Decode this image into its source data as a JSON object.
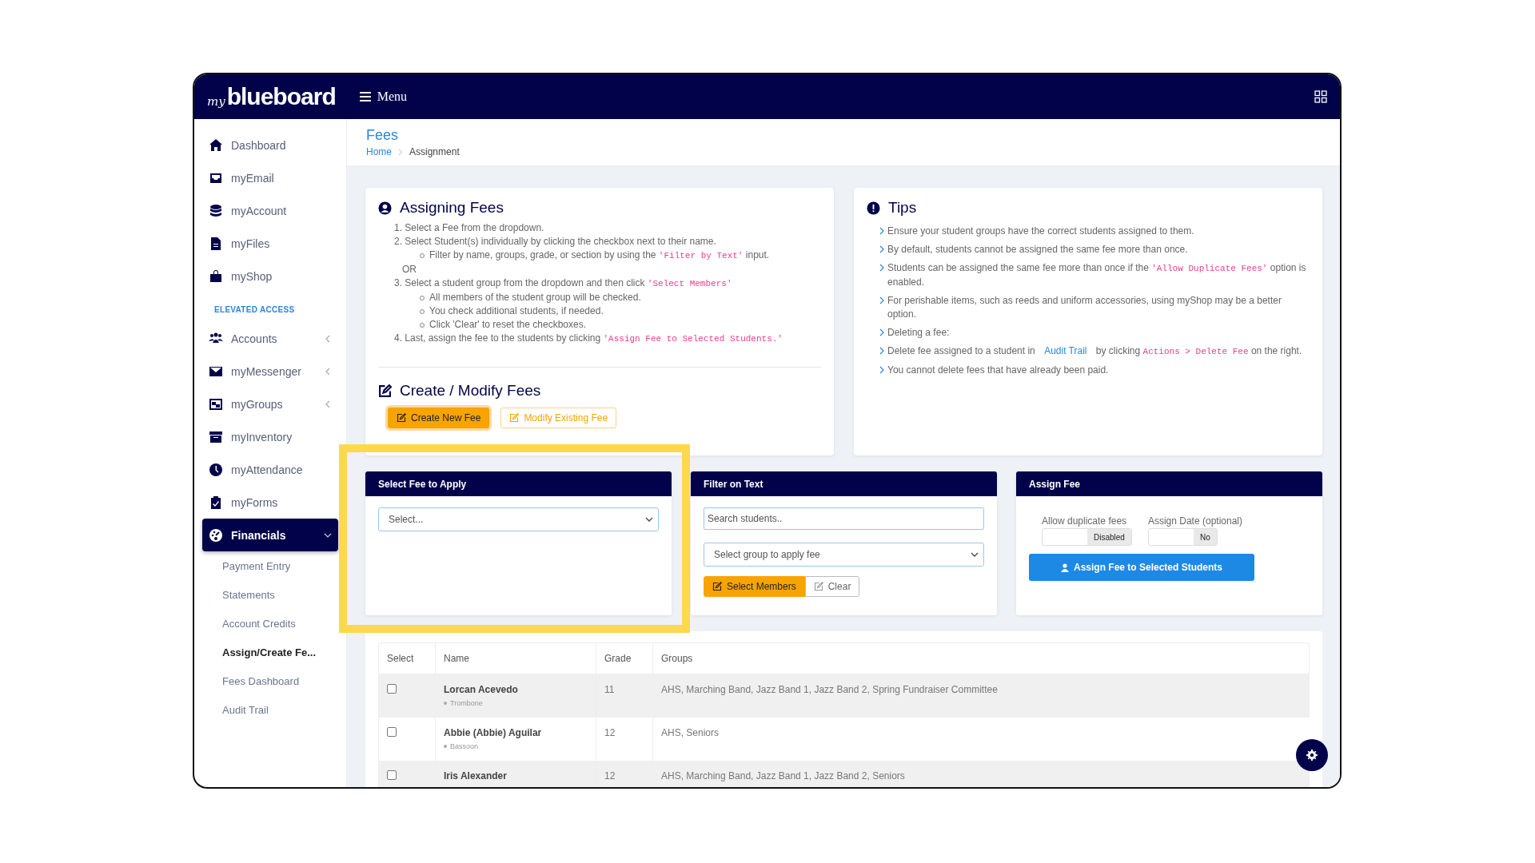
{
  "header": {
    "logo_prefix": "my",
    "logo": "blueboard",
    "menu_label": "Menu"
  },
  "sidebar": {
    "items": [
      {
        "kind": "link",
        "label": "Dashboard",
        "selected": false
      },
      {
        "kind": "link",
        "label": "myEmail",
        "selected": false
      },
      {
        "kind": "link",
        "label": "myAccount",
        "selected": false
      },
      {
        "kind": "link",
        "label": "myFiles",
        "selected": false
      },
      {
        "kind": "link",
        "label": "myShop",
        "selected": false
      },
      {
        "kind": "section",
        "label": "ELEVATED ACCESS"
      },
      {
        "kind": "group",
        "label": "Accounts",
        "selected": false,
        "expanded": false
      },
      {
        "kind": "group",
        "label": "myMessenger",
        "selected": false,
        "expanded": false
      },
      {
        "kind": "group",
        "label": "myGroups",
        "selected": false,
        "expanded": false
      },
      {
        "kind": "link",
        "label": "myInventory",
        "selected": false
      },
      {
        "kind": "link",
        "label": "myAttendance",
        "selected": false
      },
      {
        "kind": "link",
        "label": "myForms",
        "selected": false
      },
      {
        "kind": "group",
        "label": "Financials",
        "selected": true,
        "expanded": true,
        "children": [
          {
            "label": "Payment Entry",
            "selected": false
          },
          {
            "label": "Statements",
            "selected": false
          },
          {
            "label": "Account Credits",
            "selected": false
          },
          {
            "label": "Assign/Create Fe...",
            "selected": true
          },
          {
            "label": "Fees Dashboard",
            "selected": false
          },
          {
            "label": "Audit Trail",
            "selected": false
          }
        ]
      }
    ]
  },
  "page": {
    "title": "Fees",
    "breadcrumb": [
      "Home",
      "Assignment"
    ]
  },
  "assigning": {
    "title": "Assigning Fees",
    "lines": [
      {
        "kind": "step",
        "number": "1.",
        "parts": [
          {
            "kind": "text",
            "text": "Select a Fee from the dropdown."
          }
        ]
      },
      {
        "kind": "step",
        "number": "2.",
        "parts": [
          {
            "kind": "text",
            "text": "Select Student(s) individually by clicking the checkbox next to their name."
          }
        ]
      },
      {
        "kind": "sub",
        "parts": [
          {
            "kind": "text",
            "text": "Filter by name, groups, grade, or section by using the "
          },
          {
            "kind": "code",
            "text": "'Filter by Text'"
          },
          {
            "kind": "text",
            "text": " input."
          }
        ]
      },
      {
        "kind": "or",
        "parts": [
          {
            "kind": "text",
            "text": "OR"
          }
        ]
      },
      {
        "kind": "step",
        "number": "3.",
        "parts": [
          {
            "kind": "text",
            "text": "Select a student group from the dropdown and then click "
          },
          {
            "kind": "code",
            "text": "'Select Members'"
          }
        ]
      },
      {
        "kind": "sub",
        "parts": [
          {
            "kind": "text",
            "text": "All members of the student group will be checked."
          }
        ]
      },
      {
        "kind": "sub",
        "parts": [
          {
            "kind": "text",
            "text": "You check additional students, if needed."
          }
        ]
      },
      {
        "kind": "sub",
        "parts": [
          {
            "kind": "text",
            "text": "Click 'Clear' to reset the checkboxes."
          }
        ]
      },
      {
        "kind": "step",
        "number": "4.",
        "parts": [
          {
            "kind": "text",
            "text": "Last, assign the fee to the students by clicking "
          },
          {
            "kind": "code",
            "text": "'Assign Fee to Selected Students.'"
          }
        ]
      }
    ],
    "create_title": "Create / Modify Fees",
    "buttons": [
      {
        "label": "Create New Fee",
        "selected": true
      },
      {
        "label": "Modify Existing Fee",
        "selected": false
      }
    ]
  },
  "tips": {
    "title": "Tips",
    "items": [
      {
        "parts": [
          {
            "kind": "text",
            "text": "Ensure your student groups have the correct students assigned to them."
          }
        ]
      },
      {
        "parts": [
          {
            "kind": "text",
            "text": "By default, students cannot be assigned the same fee more than once."
          }
        ]
      },
      {
        "parts": [
          {
            "kind": "text",
            "text": "Students can be assigned the same fee more than once if the "
          },
          {
            "kind": "code",
            "text": "'Allow Duplicate Fees'"
          },
          {
            "kind": "text",
            "text": " option is enabled."
          }
        ]
      },
      {
        "parts": [
          {
            "kind": "text",
            "text": "For perishable items, such as reeds and uniform accessories, using myShop may be a better option."
          }
        ]
      },
      {
        "parts": [
          {
            "kind": "text",
            "text": "Deleting a fee:"
          }
        ]
      },
      {
        "parts": [
          {
            "kind": "text",
            "text": "Delete fee assigned to a student in "
          },
          {
            "kind": "link",
            "text": "Audit Trail"
          },
          {
            "kind": "text",
            "text": " by clicking "
          },
          {
            "kind": "code",
            "text": "Actions > Delete Fee"
          },
          {
            "kind": "text",
            "text": " on the right."
          }
        ]
      },
      {
        "parts": [
          {
            "kind": "text",
            "text": "You cannot delete fees that have already been paid."
          }
        ]
      }
    ]
  },
  "select_fee": {
    "title": "Select Fee to Apply",
    "dropdown": "Select..."
  },
  "filter": {
    "title": "Filter on Text",
    "search": {
      "placeholder": "Search students.."
    },
    "group_dropdown": "Select group to apply fee",
    "buttons": [
      {
        "label": "Select Members",
        "kind": "primary"
      },
      {
        "label": "Clear",
        "kind": "outline"
      }
    ]
  },
  "assign": {
    "title": "Assign Fee",
    "toggles": [
      {
        "label": "Allow duplicate fees",
        "value": "Disabled",
        "on": false
      },
      {
        "label": "Assign Date (optional)",
        "value": "No",
        "on": false
      }
    ],
    "button": "Assign Fee to Selected Students"
  },
  "table": {
    "columns": [
      "Select",
      "Name",
      "Grade",
      "Groups"
    ],
    "rows": [
      {
        "checked": false,
        "name": "Lorcan Acevedo",
        "instrument": "Trombone",
        "grade": "11",
        "groups": "AHS, Marching Band, Jazz Band 1, Jazz Band 2, Spring Fundraiser Committee"
      },
      {
        "checked": false,
        "name": "Abbie (Abbie) Aguilar",
        "instrument": "Bassoon",
        "grade": "12",
        "groups": "AHS, Seniors"
      },
      {
        "checked": false,
        "name": "Iris Alexander",
        "grade": "12",
        "groups": "AHS, Marching Band, Jazz Band 1, Jazz Band 2, Seniors"
      }
    ]
  }
}
